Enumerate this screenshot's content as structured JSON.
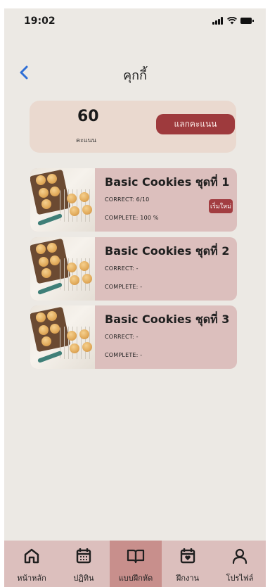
{
  "status_bar": {
    "time": "19:02"
  },
  "header": {
    "title": "คุกกี้",
    "back_icon": "chevron-left-icon"
  },
  "score": {
    "value": "60",
    "unit": "คะแนน",
    "redeem_label": "แลกคะแนน"
  },
  "sets": [
    {
      "title": "Basic Cookies ชุดที่ 1",
      "correct": "CORRECT:  6/10",
      "complete": "COMPLETE: 100 %",
      "restart_label": "เริ่มใหม่"
    },
    {
      "title": "Basic Cookies ชุดที่ 2",
      "correct": "CORRECT:  -",
      "complete": "COMPLETE: -"
    },
    {
      "title": "Basic Cookies ชุดที่ 3",
      "correct": "CORRECT:  -",
      "complete": "COMPLETE: -"
    }
  ],
  "nav": {
    "items": [
      {
        "label": "หน้าหลัก",
        "icon": "home-icon"
      },
      {
        "label": "ปฏิทิน",
        "icon": "calendar-icon"
      },
      {
        "label": "แบบฝึกหัด",
        "icon": "book-icon",
        "active": true
      },
      {
        "label": "ฝึกงาน",
        "icon": "calendar-heart-icon"
      },
      {
        "label": "โปรไฟล์",
        "icon": "profile-icon"
      }
    ]
  },
  "colors": {
    "background": "#ece9e4",
    "card": "#dcbfbd",
    "accent": "#9e3a3d",
    "score_card": "#ead9cf",
    "back_arrow": "#2f6fd6"
  }
}
